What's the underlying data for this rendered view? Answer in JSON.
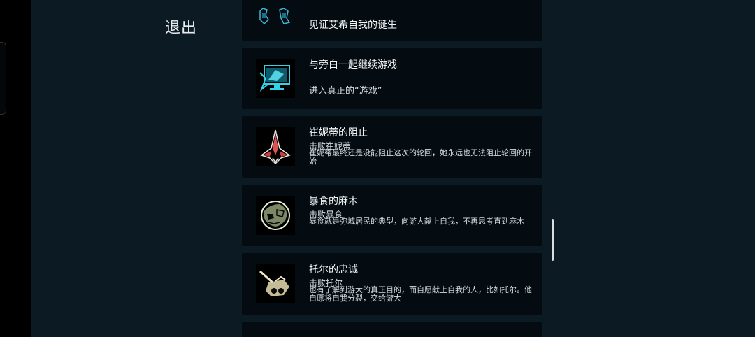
{
  "exit_label": "退出",
  "achievements": [
    {
      "icon": "twin-figures-icon",
      "title": "",
      "subtitle": "见证艾希自我的诞生",
      "description": ""
    },
    {
      "icon": "monitor-hologram-icon",
      "title": "与旁白一起继续游戏",
      "subtitle": "进入真正的“游戏”",
      "description": ""
    },
    {
      "icon": "spaceship-icon",
      "title": "崔妮蒂的阻止",
      "subtitle": "击败崔妮蒂",
      "description": "崔妮蒂最终还是没能阻止这次的轮回，她永远也无法阻止轮回的开始"
    },
    {
      "icon": "gluttony-creature-icon",
      "title": "暴食的麻木",
      "subtitle": "击败暴食",
      "description": "暴食就是弥城居民的典型，向游大献上自我，不再思考直到麻木"
    },
    {
      "icon": "thor-tank-icon",
      "title": "托尔的忠诚",
      "subtitle": "击败托尔",
      "description": "也有了解到游大的真正目的，而自愿献上自我的人，比如托尔。他自愿将自我分裂，交给游大"
    }
  ],
  "colors": {
    "background": "#0b1a23",
    "card": "#050c11",
    "accent_cyan": "#31d4e6",
    "accent_red": "#e05050"
  }
}
